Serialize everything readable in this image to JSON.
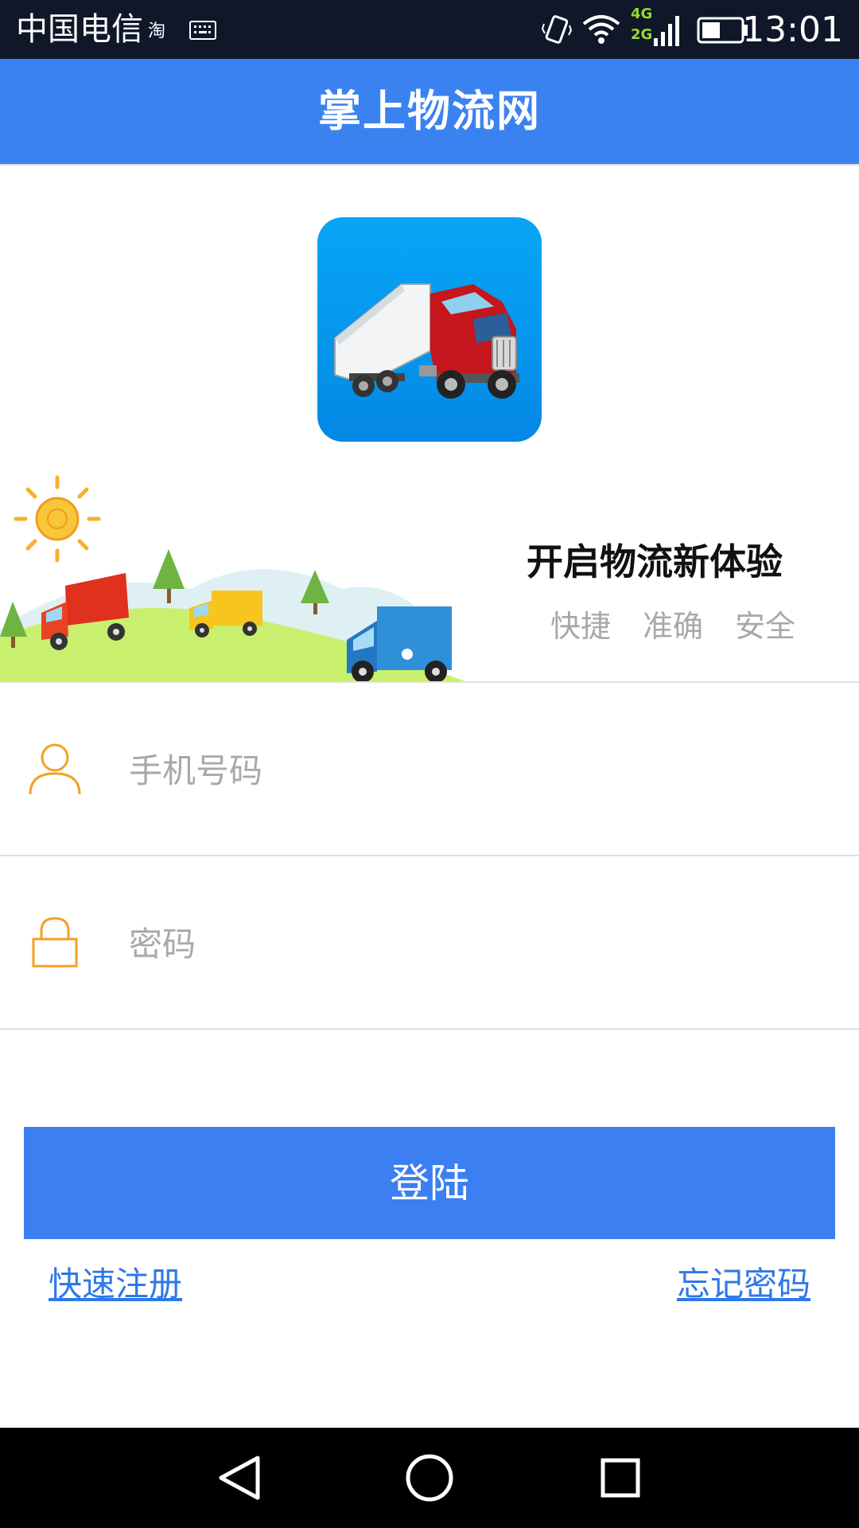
{
  "status_bar": {
    "carrier": "中国电信",
    "network_label_top": "4G",
    "network_label_bottom": "2G",
    "time": "13:01"
  },
  "header": {
    "title": "掌上物流网"
  },
  "banner": {
    "slogan": "开启物流新体验",
    "tags": [
      "快捷",
      "准确",
      "安全"
    ]
  },
  "form": {
    "phone_placeholder": "手机号码",
    "password_placeholder": "密码",
    "phone_value": "",
    "password_value": ""
  },
  "actions": {
    "login_label": "登陆",
    "register_label": "快速注册",
    "forgot_label": "忘记密码"
  },
  "colors": {
    "accent": "#3b82f1",
    "icon_orange": "#f5a023",
    "link": "#2f78e8"
  },
  "icons": {
    "phone_field": "user-icon",
    "password_field": "lock-icon"
  }
}
